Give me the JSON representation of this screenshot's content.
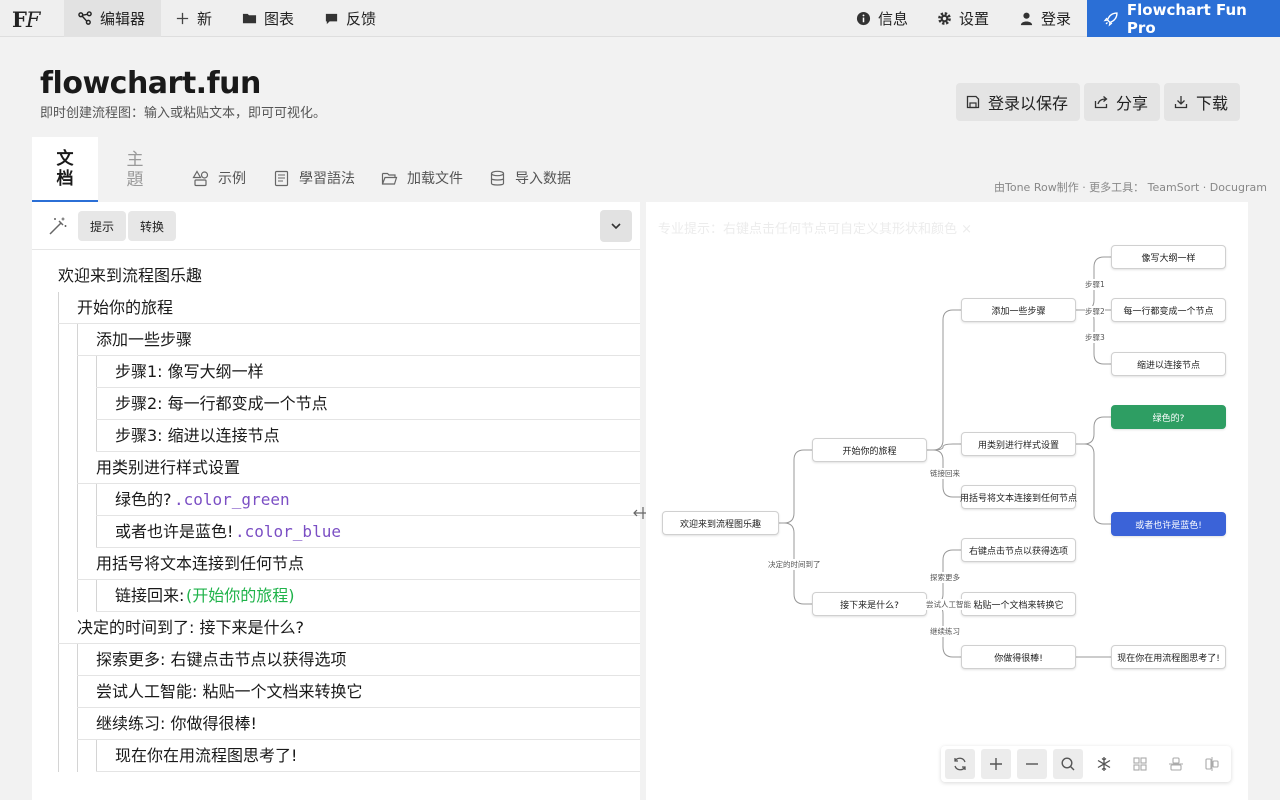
{
  "nav": {
    "logo_a": "F",
    "logo_b": "F",
    "items": [
      {
        "label": "编辑器",
        "icon": "graph-icon"
      },
      {
        "label": "新",
        "icon": "plus-icon"
      },
      {
        "label": "图表",
        "icon": "folder-icon"
      },
      {
        "label": "反馈",
        "icon": "chat-icon"
      }
    ],
    "right": [
      {
        "label": "信息",
        "icon": "info-icon"
      },
      {
        "label": "设置",
        "icon": "gear-icon"
      },
      {
        "label": "登录",
        "icon": "user-icon"
      }
    ],
    "pro_label": "Flowchart Fun Pro",
    "pro_color": "#2b6fd6"
  },
  "header": {
    "title": "flowchart.fun",
    "subtitle": "即时创建流程图：输入或粘贴文本，即可可视化。",
    "buttons": [
      {
        "label": "登录以保存",
        "icon": "save-icon"
      },
      {
        "label": "分享",
        "icon": "share-icon"
      },
      {
        "label": "下载",
        "icon": "download-icon"
      }
    ]
  },
  "tabs": {
    "doc": [
      "文",
      "档"
    ],
    "theme": [
      "主",
      "題"
    ],
    "sub": [
      {
        "label": "示例",
        "icon": "shapes-icon"
      },
      {
        "label": "學習語法",
        "icon": "book-icon"
      },
      {
        "label": "加载文件",
        "icon": "folder-open-icon"
      },
      {
        "label": "导入数据",
        "icon": "database-icon"
      }
    ],
    "credits": "由Tone Row制作 · 更多工具： TeamSort · Docugram"
  },
  "editor": {
    "hint_label": "提示",
    "convert_label": "转换",
    "lines": [
      {
        "text": "欢迎来到流程图乐趣",
        "indent": 0
      },
      {
        "text": "开始你的旅程",
        "indent": 1
      },
      {
        "text": "添加一些步骤",
        "indent": 2
      },
      {
        "text": "步骤1: 像写大纲一样",
        "indent": 3
      },
      {
        "text": "步骤2: 每一行都变成一个节点",
        "indent": 3
      },
      {
        "text": "步骤3: 缩进以连接节点",
        "indent": 3
      },
      {
        "text": "用类别进行样式设置",
        "indent": 2
      },
      {
        "text": "绿色的? ",
        "cls": ".color_green",
        "indent": 3
      },
      {
        "text": "或者也许是蓝色! ",
        "cls": ".color_blue",
        "indent": 3
      },
      {
        "text": "用括号将文本连接到任何节点",
        "indent": 2
      },
      {
        "text": "链接回来: ",
        "ref": "(开始你的旅程)",
        "indent": 3
      },
      {
        "text": "决定的时间到了: 接下来是什么?",
        "indent": 1
      },
      {
        "text": "探索更多: 右键点击节点以获得选项",
        "indent": 2
      },
      {
        "text": "尝试人工智能: 粘贴一个文档来转换它",
        "indent": 2
      },
      {
        "text": "继续练习: 你做得很棒!",
        "indent": 2
      },
      {
        "text": "现在你在用流程图思考了!",
        "indent": 3
      }
    ]
  },
  "canvas": {
    "tip": "专业提示：右键点击任何节点可自定义其形状和颜色 ×",
    "nodes": {
      "root": "欢迎来到流程图乐趣",
      "start": "开始你的旅程",
      "next": "接下来是什么?",
      "steps": "添加一些步骤",
      "style": "用类别进行样式设置",
      "link": "用括号将文本连接到任何节点",
      "rightclick": "右键点击节点以获得选项",
      "paste": "粘贴一个文档来转换它",
      "great": "你做得很棒!",
      "outline": "像写大纲一样",
      "eachline": "每一行都变成一个节点",
      "indent": "缩进以连接节点",
      "green": "绿色的?",
      "blue": "或者也许是蓝色!",
      "thinking": "现在你在用流程图思考了!"
    },
    "edge_labels": {
      "decide": "决定的时间到了",
      "linkback": "链接回来",
      "step1": "步骤1",
      "step2": "步骤2",
      "step3": "步骤3",
      "explore": "探索更多",
      "ai": "尝试人工智能",
      "practice": "继续练习"
    },
    "colors": {
      "green": "#2e9e63",
      "blue": "#3b63d8"
    }
  },
  "controls": [
    "refresh-icon",
    "zoom-in-icon",
    "zoom-out-icon",
    "search-icon",
    "snowflake-icon",
    "grid-icon",
    "align-icon",
    "columns-icon"
  ]
}
